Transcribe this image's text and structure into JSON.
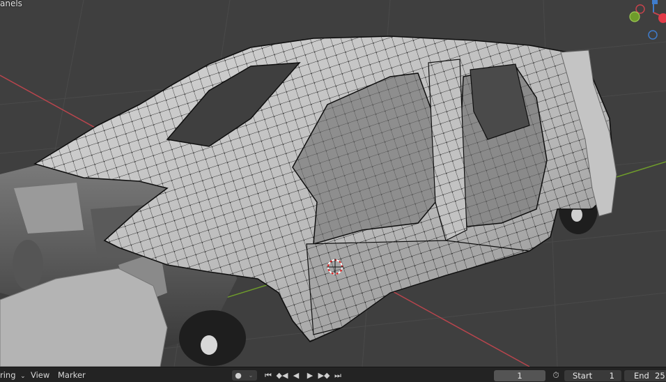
{
  "viewport": {
    "panel_label": "anels",
    "background": "#3f3f3f",
    "axis_x_color": "#b8454d",
    "axis_y_color": "#6f9c2b",
    "mesh_color": "#c9c9c9",
    "vertex_color": "#0a0a0a",
    "gizmo_icons": [
      "axis-x-handle-icon",
      "axis-y-handle-icon",
      "axis-z-handle-icon",
      "axis-x-positive-icon",
      "axis-x-negative-icon",
      "axis-y-negative-icon"
    ]
  },
  "timeline": {
    "mode_label": "ring",
    "view_label": "View",
    "marker_label": "Marker",
    "playback_icons": [
      "record-icon",
      "jump-start-icon",
      "keyframe-prev-icon",
      "play-reverse-icon",
      "play-icon",
      "keyframe-next-icon",
      "jump-end-icon"
    ],
    "current_frame": "1",
    "start_label": "Start",
    "start_value": "1",
    "end_label": "End",
    "end_value": "25"
  }
}
